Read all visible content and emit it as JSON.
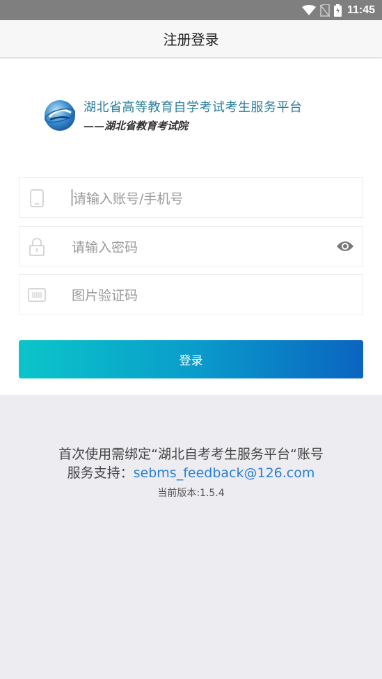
{
  "status_bar": {
    "time": "11:45",
    "icons": [
      "wifi-icon",
      "no-sim-icon",
      "battery-charging-icon"
    ]
  },
  "header": {
    "title": "注册登录"
  },
  "logo": {
    "title": "湖北省高等教育自学考试考生服务平台",
    "subtitle": "——湖北省教育考试院",
    "icon": "globe-logo-icon"
  },
  "form": {
    "account": {
      "placeholder": "请输入账号/手机号",
      "icon": "phone-icon"
    },
    "password": {
      "placeholder": "请输入密码",
      "icon": "lock-icon",
      "toggle_icon": "eye-icon"
    },
    "captcha": {
      "placeholder": "图片验证码",
      "icon": "barcode-icon"
    },
    "submit_label": "登录"
  },
  "footer": {
    "notice": "首次使用需绑定“湖北自考考生服务平台“账号",
    "support_label": "服务支持：",
    "support_email": "sebms_feedback@126.com",
    "version": "当前版本:1.5.4"
  },
  "colors": {
    "brand_text": "#2a7e9c",
    "button_gradient_start": "#0bc5c9",
    "button_gradient_end": "#0a64c0",
    "link": "#2a7fd4",
    "background": "#edecf1"
  }
}
